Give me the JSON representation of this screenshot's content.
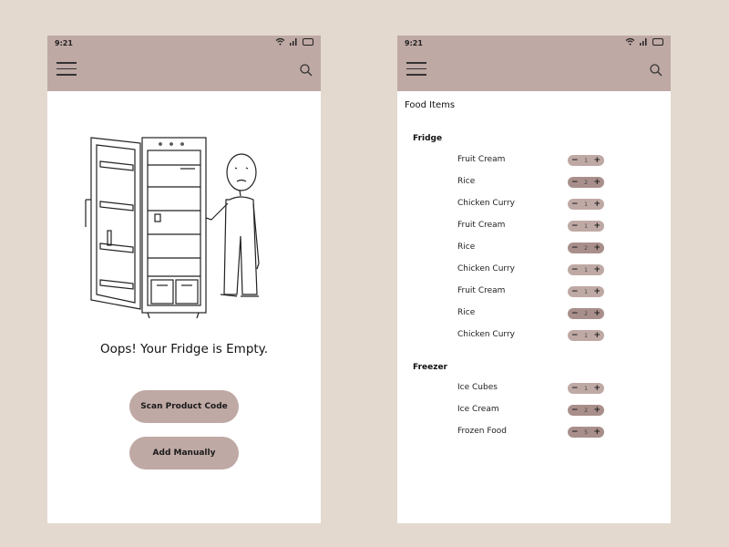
{
  "screens": [
    {
      "status_time": "9:21",
      "empty_message": "Oops! Your Fridge is Empty.",
      "scan_button_label": "Scan Product Code",
      "manual_button_label": "Add Manually"
    },
    {
      "status_time": "9:21",
      "title": "Food Items",
      "groups": [
        {
          "label": "Fridge",
          "items": [
            {
              "name": "Fruit Cream",
              "qty": "1"
            },
            {
              "name": "Rice",
              "qty": "2"
            },
            {
              "name": "Chicken Curry",
              "qty": "1"
            },
            {
              "name": "Fruit Cream",
              "qty": "1"
            },
            {
              "name": "Rice",
              "qty": "2"
            },
            {
              "name": "Chicken Curry",
              "qty": "1"
            },
            {
              "name": "Fruit Cream",
              "qty": "1"
            },
            {
              "name": "Rice",
              "qty": "2"
            },
            {
              "name": "Chicken Curry",
              "qty": "1"
            }
          ]
        },
        {
          "label": "Freezer",
          "items": [
            {
              "name": "Ice Cubes",
              "qty": "1"
            },
            {
              "name": "Ice Cream",
              "qty": "2"
            },
            {
              "name": "Frozen Food",
              "qty": "5"
            }
          ]
        }
      ]
    }
  ],
  "stepper": {
    "minus": "−",
    "plus": "+"
  },
  "colors": {
    "background": "#e3d9cf",
    "appbar": "#bfa9a5",
    "screen": "#ffffff"
  },
  "icons": [
    "menu-icon",
    "search-icon",
    "wifi-icon",
    "signal-icon",
    "battery-icon"
  ]
}
